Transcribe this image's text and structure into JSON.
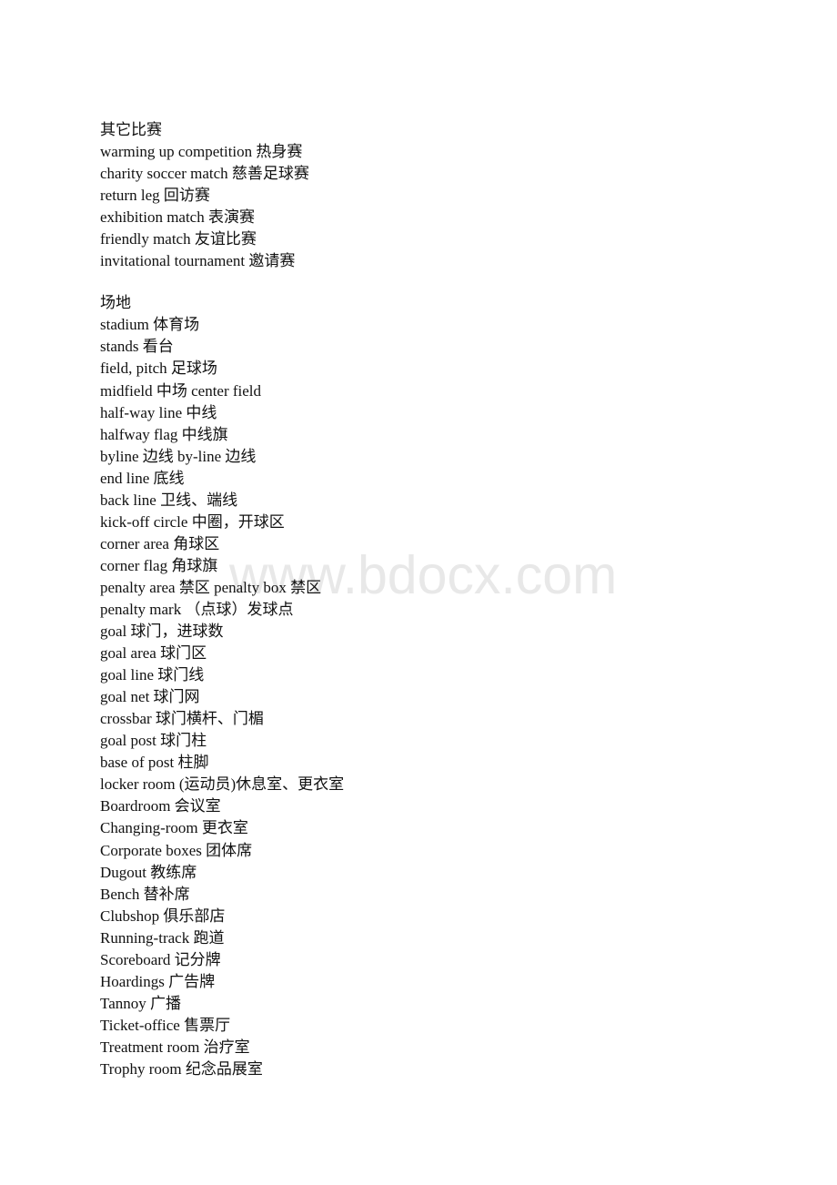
{
  "watermark": "www.bdocx.com",
  "sections": [
    {
      "heading": "其它比赛",
      "entries": [
        "warming up competition 热身赛",
        "charity soccer match 慈善足球赛",
        "return leg 回访赛",
        "exhibition match 表演赛",
        "friendly match 友谊比赛",
        "invitational tournament 邀请赛"
      ]
    },
    {
      "heading": "场地",
      "entries": [
        "stadium 体育场",
        "stands 看台",
        "field, pitch 足球场",
        "midfield 中场 center field",
        "half-way line 中线",
        "halfway flag 中线旗",
        "byline 边线 by-line 边线",
        "end line 底线",
        "back line 卫线、端线",
        "kick-off circle 中圈，开球区",
        "corner area 角球区",
        "corner flag 角球旗",
        "penalty area 禁区 penalty box 禁区",
        "penalty mark （点球）发球点",
        "goal 球门，进球数",
        "goal area 球门区",
        "goal line 球门线",
        "goal net 球门网",
        "crossbar 球门横杆、门楣",
        "goal post 球门柱",
        "base of post 柱脚",
        "locker room (运动员)休息室、更衣室",
        "Boardroom 会议室",
        "Changing-room 更衣室",
        "Corporate boxes 团体席",
        "Dugout 教练席",
        "Bench 替补席",
        "Clubshop 俱乐部店",
        "Running-track 跑道",
        "Scoreboard 记分牌",
        "Hoardings 广告牌",
        "Tannoy 广播",
        "Ticket-office 售票厅",
        "Treatment room 治疗室",
        "Trophy room 纪念品展室"
      ]
    }
  ]
}
